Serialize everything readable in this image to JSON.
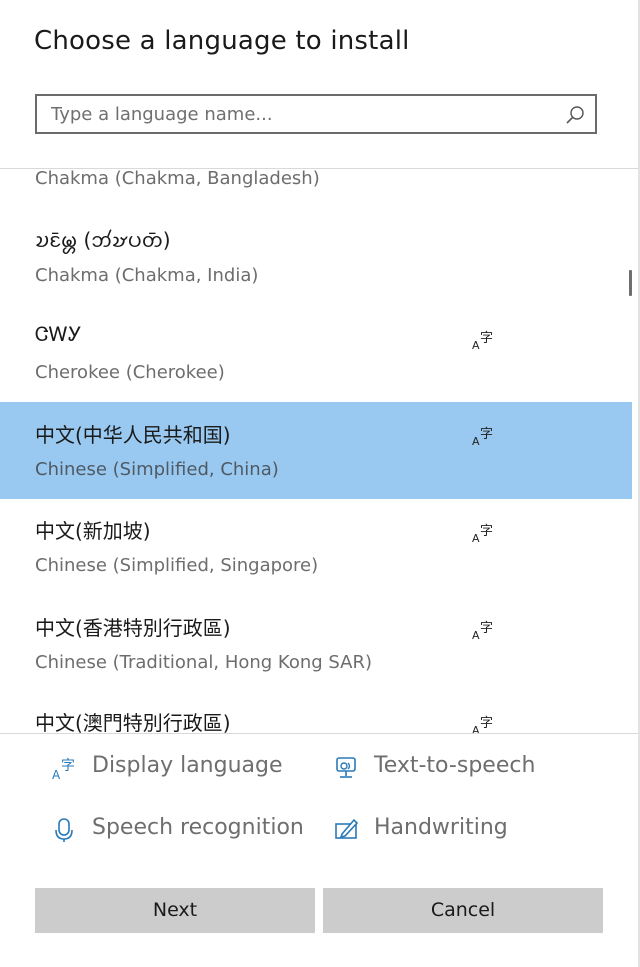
{
  "dialog": {
    "title": "Choose a language to install"
  },
  "search": {
    "placeholder": "Type a language name..."
  },
  "languages": [
    {
      "native": "",
      "english": "Chakma (Chakma, Bangladesh)",
      "display_language": false,
      "selected": false
    },
    {
      "native": "𑄌𑄋𑄴𑄟𑄳𑄦 (𑄃𑄧𑄏𑄛𑄖𑄴)",
      "english": "Chakma (Chakma, India)",
      "display_language": false,
      "selected": false
    },
    {
      "native": "ᏣᎳᎩ",
      "english": "Cherokee (Cherokee)",
      "display_language": true,
      "selected": false
    },
    {
      "native": "中文(中华人民共和国)",
      "english": "Chinese (Simplified, China)",
      "display_language": true,
      "selected": true
    },
    {
      "native": "中文(新加坡)",
      "english": "Chinese (Simplified, Singapore)",
      "display_language": true,
      "selected": false
    },
    {
      "native": "中文(香港特別行政區)",
      "english": "Chinese (Traditional, Hong Kong SAR)",
      "display_language": true,
      "selected": false
    },
    {
      "native": "中文(澳門特別行政區)",
      "english": "",
      "display_language": true,
      "selected": false
    }
  ],
  "features": {
    "display_language": {
      "label": "Display language",
      "icon": "display-language-icon"
    },
    "text_to_speech": {
      "label": "Text-to-speech",
      "icon": "text-to-speech-icon"
    },
    "speech_recognition": {
      "label": "Speech recognition",
      "icon": "microphone-icon"
    },
    "handwriting": {
      "label": "Handwriting",
      "icon": "pen-icon"
    }
  },
  "buttons": {
    "next": "Next",
    "cancel": "Cancel"
  },
  "colors": {
    "selected_row": "#99c9f0",
    "accent_icon": "#2a7ab8",
    "button_bg": "#cccccc"
  }
}
